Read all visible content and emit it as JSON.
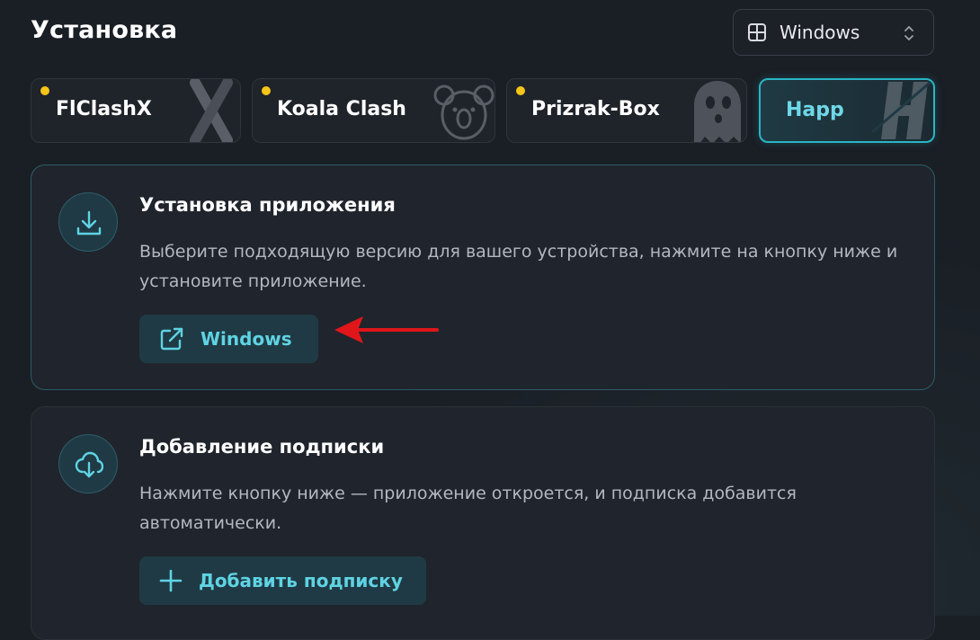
{
  "page_title": "Установка",
  "os_select": {
    "value": "Windows",
    "icon": "windows-icon"
  },
  "tabs": [
    {
      "label": "FlClashX",
      "has_dot": true,
      "active": false,
      "icon": "flclashx-logo"
    },
    {
      "label": "Koala Clash",
      "has_dot": true,
      "active": false,
      "icon": "koala-logo"
    },
    {
      "label": "Prizrak-Box",
      "has_dot": true,
      "active": false,
      "icon": "ghost-logo"
    },
    {
      "label": "Happ",
      "has_dot": false,
      "active": true,
      "icon": "happ-logo"
    }
  ],
  "colors": {
    "accent": "#2ab5c4",
    "accent_text": "#5fd3e3",
    "dot": "#f5c518",
    "arrow": "#e0161b",
    "background": "#1a1e25",
    "card": "#20242c"
  },
  "install_card": {
    "icon": "download-icon",
    "title": "Установка приложения",
    "description": "Выберите подходящую версию для вашего устройства, нажмите на кнопку ниже и установите приложение.",
    "button": {
      "label": "Windows",
      "icon": "external-link-icon"
    }
  },
  "subscription_card": {
    "icon": "cloud-download-icon",
    "title": "Добавление подписки",
    "description": "Нажмите кнопку ниже — приложение откроется, и подписка добавится автоматически.",
    "button": {
      "label": "Добавить подписку",
      "icon": "plus-icon"
    }
  },
  "annotation": {
    "icon": "red-arrow-icon"
  }
}
